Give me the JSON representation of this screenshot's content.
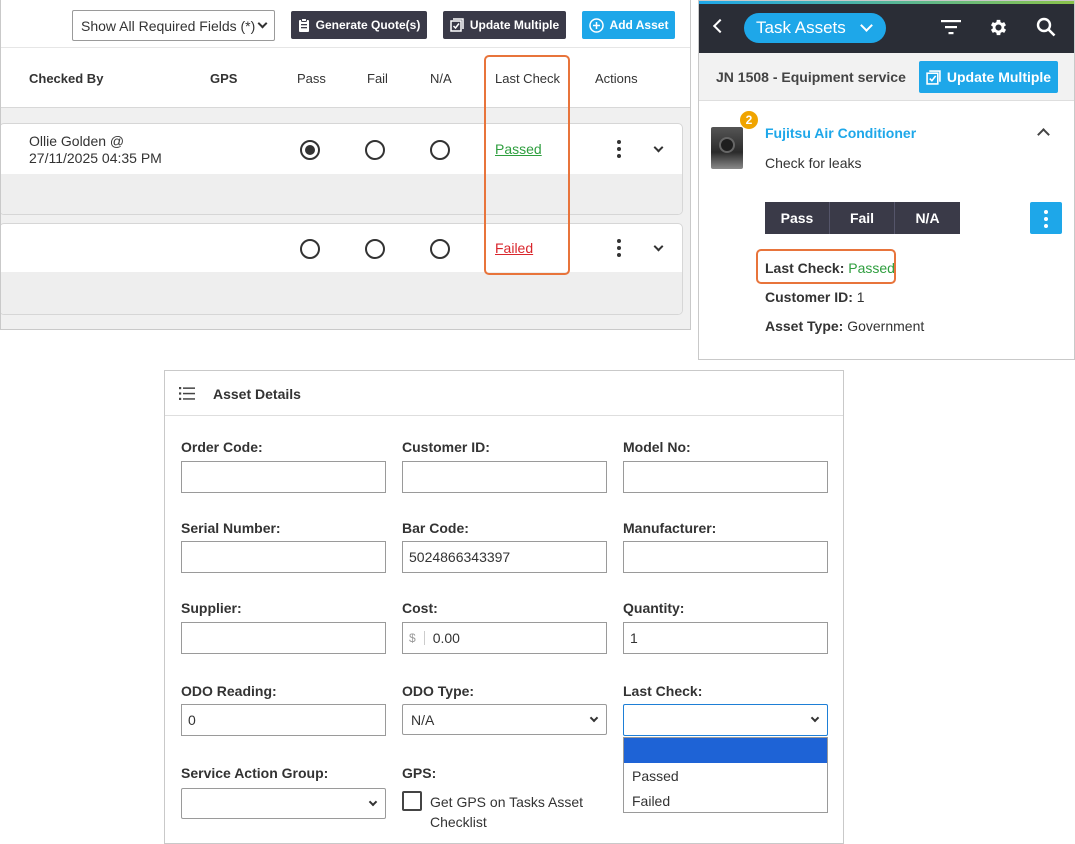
{
  "table_view": {
    "filter_select": "Show All Required Fields (*)",
    "buttons": {
      "generate_quotes": "Generate Quote(s)",
      "update_multiple": "Update Multiple",
      "add_asset": "Add Asset"
    },
    "columns": [
      "Checked By",
      "GPS",
      "Pass",
      "Fail",
      "N/A",
      "Last Check",
      "Actions"
    ],
    "rows": [
      {
        "checked_by_line1": "Ollie Golden @",
        "checked_by_line2": "27/11/2025 04:35 PM",
        "selected": "pass",
        "last_check": "Passed",
        "last_check_color": "#2e9e3e"
      },
      {
        "checked_by_line1": "",
        "checked_by_line2": "",
        "selected": "",
        "last_check": "Failed",
        "last_check_color": "#d9262c"
      }
    ],
    "highlight_color": "#e8743b"
  },
  "mobile_view": {
    "app_title": "Task Assets",
    "job_title": "JN 1508 - Equipment service",
    "update_multiple": "Update Multiple",
    "asset": {
      "badge_count": "2",
      "name": "Fujitsu Air Conditioner",
      "task": "Check for leaks",
      "segment_buttons": [
        "Pass",
        "Fail",
        "N/A"
      ],
      "last_check_label": "Last Check:",
      "last_check_value": "Passed",
      "customer_id_label": "Customer ID:",
      "customer_id_value": "1",
      "asset_type_label": "Asset Type:",
      "asset_type_value": "Government"
    },
    "accent_color": "#1ea7e9"
  },
  "asset_details": {
    "title": "Asset Details",
    "fields": {
      "order_code": {
        "label": "Order Code:",
        "value": ""
      },
      "customer_id": {
        "label": "Customer ID:",
        "value": ""
      },
      "model_no": {
        "label": "Model No:",
        "value": ""
      },
      "serial_number": {
        "label": "Serial Number:",
        "value": ""
      },
      "bar_code": {
        "label": "Bar Code:",
        "value": "5024866343397"
      },
      "manufacturer": {
        "label": "Manufacturer:",
        "value": ""
      },
      "supplier": {
        "label": "Supplier:",
        "value": ""
      },
      "cost": {
        "label": "Cost:",
        "prefix": "$",
        "value": "0.00"
      },
      "quantity": {
        "label": "Quantity:",
        "value": "1"
      },
      "odo_reading": {
        "label": "ODO Reading:",
        "value": "0"
      },
      "odo_type": {
        "label": "ODO Type:",
        "value": "N/A"
      },
      "last_check": {
        "label": "Last Check:",
        "value": "",
        "options": [
          "",
          "Passed",
          "Failed"
        ]
      },
      "service_action_group": {
        "label": "Service Action Group:",
        "value": ""
      },
      "gps": {
        "label": "GPS:",
        "checkbox_line1": "Get GPS on Tasks Asset",
        "checkbox_line2": "Checklist",
        "checked": false
      }
    }
  }
}
